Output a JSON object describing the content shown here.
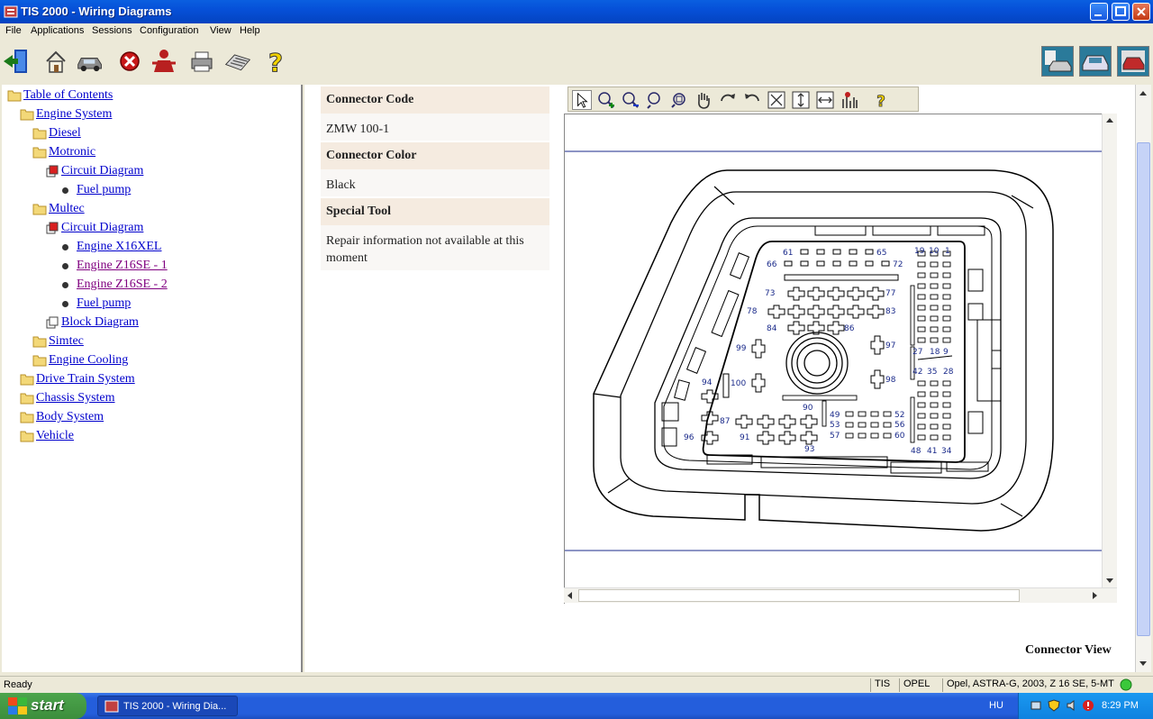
{
  "window": {
    "title": "TIS 2000 - Wiring Diagrams"
  },
  "menu": [
    "File",
    "Applications",
    "Sessions",
    "Configuration",
    "View",
    "Help"
  ],
  "tree": {
    "root": "Table of Contents",
    "items": {
      "engine_system": "Engine System",
      "diesel": "Diesel",
      "motronic": "Motronic",
      "motronic_circuit": "Circuit Diagram",
      "motronic_fuel": "Fuel pump",
      "multec": "Multec",
      "multec_circuit": "Circuit Diagram",
      "x16xel": "Engine X16XEL",
      "z16se1": "Engine Z16SE - 1",
      "z16se2": "Engine Z16SE - 2",
      "multec_fuel": "Fuel pump",
      "block": "Block Diagram",
      "simtec": "Simtec",
      "cooling": "Engine Cooling",
      "drivetrain": "Drive Train System",
      "chassis": "Chassis System",
      "body": "Body System",
      "vehicle": "Vehicle"
    }
  },
  "info": {
    "code_label": "Connector Code",
    "code_value": "ZMW 100-1",
    "color_label": "Connector Color",
    "color_value": "Black",
    "tool_label": "Special Tool",
    "tool_value": "Repair information not available at this moment"
  },
  "viewer": {
    "caption": "Connector View",
    "pins": {
      "p61": "61",
      "p65": "65",
      "p66": "66",
      "p72": "72",
      "p19": "19",
      "p10": "10",
      "p1": "1",
      "p73": "73",
      "p77": "77",
      "p78": "78",
      "p83": "83",
      "p84": "84",
      "p86": "86",
      "p99": "99",
      "p97": "97",
      "p27": "27",
      "p18": "18",
      "p9": "9",
      "p42": "42",
      "p35": "35",
      "p28": "28",
      "p94": "94",
      "p100": "100",
      "p98": "98",
      "p90": "90",
      "p49": "49",
      "p52": "52",
      "p53": "53",
      "p56": "56",
      "p57": "57",
      "p60": "60",
      "p87": "87",
      "p91": "91",
      "p96": "96",
      "p93": "93",
      "p48": "48",
      "p41": "41",
      "p34": "34"
    }
  },
  "status": {
    "ready": "Ready",
    "app": "TIS",
    "brand": "OPEL",
    "vehicle": "Opel, ASTRA-G, 2003, Z 16 SE, 5-MT"
  },
  "taskbar": {
    "start": "start",
    "task": "TIS 2000 - Wiring Dia...",
    "lang": "HU",
    "time": "8:29 PM"
  },
  "colors": {
    "titlebar": "#0650d8",
    "link": "#0000cc",
    "visited": "#800080",
    "pin_label": "#1a2a8a"
  }
}
